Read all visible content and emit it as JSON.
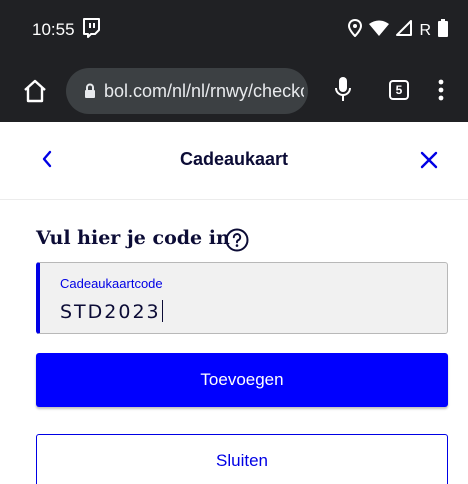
{
  "status_bar": {
    "time": "10:55",
    "network_label": "R"
  },
  "browser": {
    "url": "bol.com/nl/nl/rnwy/checkout",
    "tab_count": "5"
  },
  "header": {
    "title": "Cadeaukaart"
  },
  "form": {
    "heading": "Vul hier je code in",
    "code_label": "Cadeaukaartcode",
    "code_value": "STD2023"
  },
  "buttons": {
    "add_label": "Toevoegen",
    "close_label": "Sluiten"
  },
  "colors": {
    "status_bar_bg": "#202124",
    "brand_blue": "#0000ff",
    "text_dark": "#0c0c36"
  }
}
